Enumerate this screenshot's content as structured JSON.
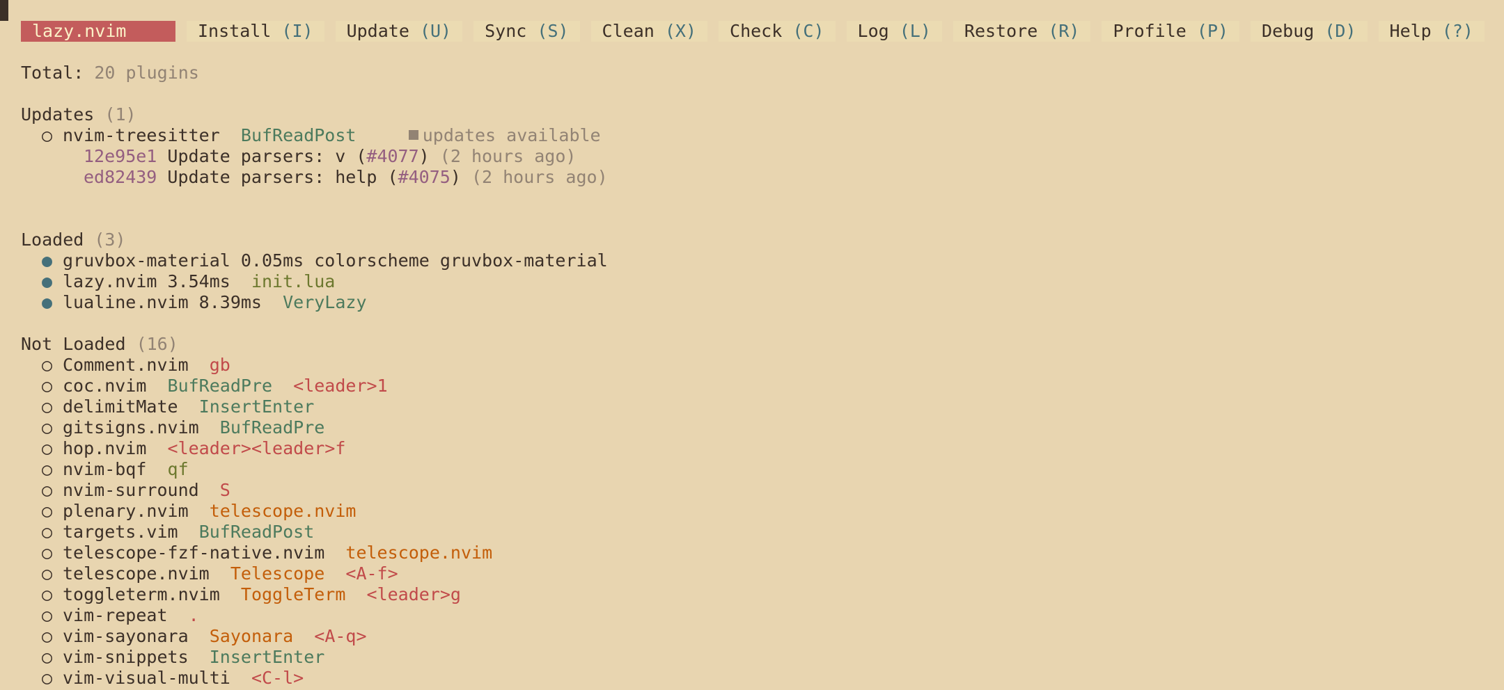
{
  "toolbar": {
    "title": "lazy.nvim",
    "buttons": [
      {
        "label": "Install",
        "key": "(I)"
      },
      {
        "label": "Update",
        "key": "(U)"
      },
      {
        "label": "Sync",
        "key": "(S)"
      },
      {
        "label": "Clean",
        "key": "(X)"
      },
      {
        "label": "Check",
        "key": "(C)"
      },
      {
        "label": "Log",
        "key": "(L)"
      },
      {
        "label": "Restore",
        "key": "(R)"
      },
      {
        "label": "Profile",
        "key": "(P)"
      },
      {
        "label": "Debug",
        "key": "(D)"
      },
      {
        "label": "Help",
        "key": "(?)"
      }
    ]
  },
  "total": {
    "label": "Total:",
    "value": "20 plugins"
  },
  "updates": {
    "heading": "Updates",
    "count": "(1)",
    "plugin": {
      "bullet": "○",
      "name": "nvim-treesitter",
      "event": "BufReadPost",
      "status": "updates available"
    },
    "commits": [
      {
        "hash": "12e95e1",
        "message": "Update parsers: v (",
        "ref": "#4077",
        "close": ")",
        "time": "(2 hours ago)"
      },
      {
        "hash": "ed82439",
        "message": "Update parsers: help (",
        "ref": "#4075",
        "close": ")",
        "time": "(2 hours ago)"
      }
    ]
  },
  "loaded": {
    "heading": "Loaded",
    "count": "(3)",
    "items": [
      {
        "bullet": "●",
        "text": "gruvbox-material 0.05ms colorscheme gruvbox-material",
        "extra": ""
      },
      {
        "bullet": "●",
        "text": "lazy.nvim 3.54ms",
        "extra": "init.lua"
      },
      {
        "bullet": "●",
        "text": "lualine.nvim 8.39ms",
        "extra": "VeryLazy"
      }
    ]
  },
  "not_loaded": {
    "heading": "Not Loaded",
    "count": "(16)",
    "items": [
      {
        "bullet": "○",
        "name": "Comment.nvim",
        "t1": "gb",
        "t2": ""
      },
      {
        "bullet": "○",
        "name": "coc.nvim",
        "t1": "BufReadPre",
        "t2": "<leader>1"
      },
      {
        "bullet": "○",
        "name": "delimitMate",
        "t1": "InsertEnter",
        "t2": ""
      },
      {
        "bullet": "○",
        "name": "gitsigns.nvim",
        "t1": "BufReadPre",
        "t2": ""
      },
      {
        "bullet": "○",
        "name": "hop.nvim",
        "t1": "<leader><leader>f",
        "t2": ""
      },
      {
        "bullet": "○",
        "name": "nvim-bqf",
        "t1": "qf",
        "t2": ""
      },
      {
        "bullet": "○",
        "name": "nvim-surround",
        "t1": "S",
        "t2": ""
      },
      {
        "bullet": "○",
        "name": "plenary.nvim",
        "t1": "telescope.nvim",
        "t2": ""
      },
      {
        "bullet": "○",
        "name": "targets.vim",
        "t1": "BufReadPost",
        "t2": ""
      },
      {
        "bullet": "○",
        "name": "telescope-fzf-native.nvim",
        "t1": "telescope.nvim",
        "t2": ""
      },
      {
        "bullet": "○",
        "name": "telescope.nvim",
        "t1": "Telescope",
        "t2": "<A-f>"
      },
      {
        "bullet": "○",
        "name": "toggleterm.nvim",
        "t1": "ToggleTerm",
        "t2": "<leader>g"
      },
      {
        "bullet": "○",
        "name": "vim-repeat",
        "t1": ".",
        "t2": ""
      },
      {
        "bullet": "○",
        "name": "vim-sayonara",
        "t1": "Sayonara",
        "t2": "<A-q>"
      },
      {
        "bullet": "○",
        "name": "vim-snippets",
        "t1": "InsertEnter",
        "t2": ""
      },
      {
        "bullet": "○",
        "name": "vim-visual-multi",
        "t1": "<C-l>",
        "t2": ""
      }
    ]
  },
  "colors": {
    "background": "#e8d5b0",
    "title_bg": "#c35c5c",
    "key": "#45707a",
    "event": "#4c7a5d",
    "keymap": "#c14a4a",
    "command": "#c35e0a",
    "hash": "#945e80"
  }
}
